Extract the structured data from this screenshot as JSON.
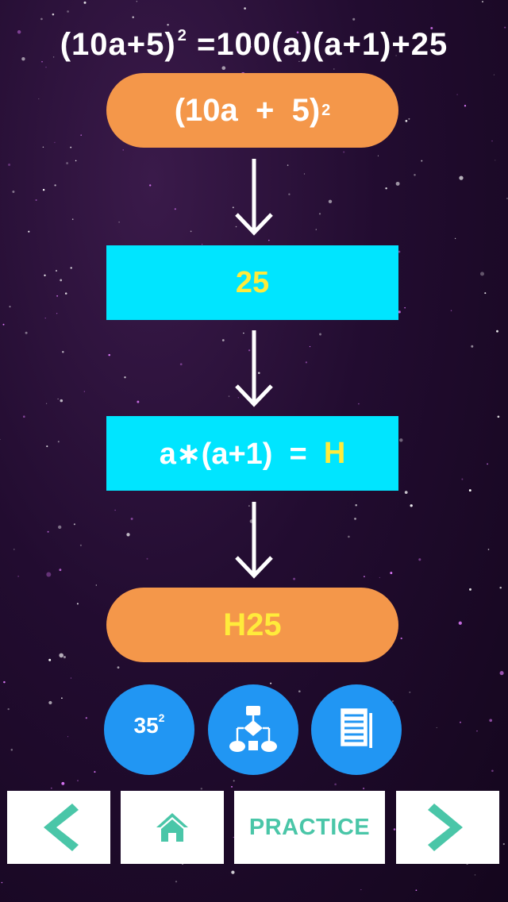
{
  "formula": {
    "base": "(10a+5)",
    "exp": "2",
    "rhs": "=100(a)(a+1)+25"
  },
  "steps": {
    "start": {
      "base": "(10a  +  5)",
      "exp": "2"
    },
    "last_digits": "25",
    "multiply": {
      "expr": "a∗(a+1)  =  ",
      "var": "H"
    },
    "result": "H25"
  },
  "actions": {
    "example": {
      "base": "35",
      "exp": "2"
    },
    "flowchart_icon": "flowchart-icon",
    "notes_icon": "document-icon"
  },
  "nav": {
    "practice_label": "PRACTICE",
    "prev_icon": "chevron-left-icon",
    "home_icon": "home-icon",
    "next_icon": "chevron-right-icon"
  },
  "colors": {
    "orange": "#f4974a",
    "cyan": "#00e5ff",
    "yellow": "#ffeb3b",
    "blue": "#2196f3",
    "teal": "#4ac6a8"
  }
}
